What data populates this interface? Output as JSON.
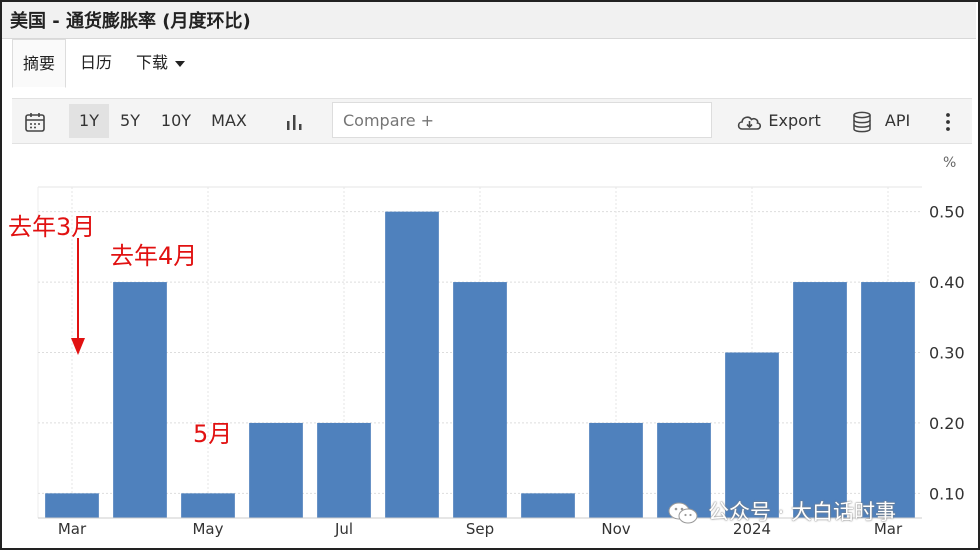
{
  "window": {
    "title": "美国 - 通货膨胀率 (月度环比)"
  },
  "tabs": [
    {
      "label": "摘要",
      "active": true
    },
    {
      "label": "日历",
      "active": false
    },
    {
      "label": "下载",
      "active": false,
      "dropdown": true
    }
  ],
  "toolbar": {
    "ranges": [
      {
        "label": "1Y",
        "selected": true
      },
      {
        "label": "5Y",
        "selected": false
      },
      {
        "label": "10Y",
        "selected": false
      },
      {
        "label": "MAX",
        "selected": false
      }
    ],
    "compare_placeholder": "Compare +",
    "export_label": "Export",
    "api_label": "API"
  },
  "chart_data": {
    "type": "bar",
    "ylabel": "%",
    "ylim": [
      0.065,
      0.535
    ],
    "yticks": [
      0.1,
      0.2,
      0.3,
      0.4,
      0.5
    ],
    "ytick_labels": [
      "0.10",
      "0.20",
      "0.30",
      "0.40",
      "0.50"
    ],
    "categories": [
      "2023-03",
      "2023-04",
      "2023-05",
      "2023-06",
      "2023-07",
      "2023-08",
      "2023-09",
      "2023-10",
      "2023-11",
      "2023-12",
      "2024-01",
      "2024-02",
      "2024-03"
    ],
    "values": [
      0.1,
      0.4,
      0.1,
      0.2,
      0.2,
      0.5,
      0.4,
      0.1,
      0.2,
      0.2,
      0.3,
      0.4,
      0.4
    ],
    "xtick_labels": [
      {
        "index": 0,
        "label": "Mar"
      },
      {
        "index": 2,
        "label": "May"
      },
      {
        "index": 4,
        "label": "Jul"
      },
      {
        "index": 6,
        "label": "Sep"
      },
      {
        "index": 8,
        "label": "Nov"
      },
      {
        "index": 10,
        "label": "2024"
      },
      {
        "index": 12,
        "label": "Mar"
      }
    ],
    "grid": true,
    "bar_color": "#4f81bd"
  },
  "annotations": [
    {
      "label": "去年3月"
    },
    {
      "label": "去年4月"
    },
    {
      "label": "5月"
    }
  ],
  "annotation_color": "#e11111",
  "watermark": "公众号 · 大白话时事"
}
